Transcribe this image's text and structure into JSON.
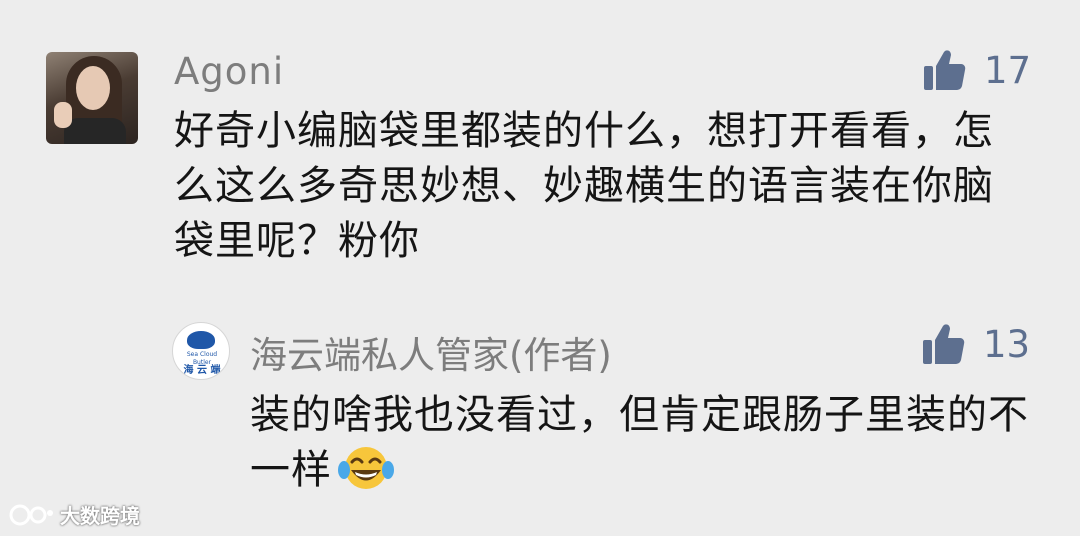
{
  "comment": {
    "username": "Agoni",
    "text": "好奇小编脑袋里都装的什么，想打开看看，怎么这么多奇思妙想、妙趣横生的语言装在你脑袋里呢？粉你",
    "likes": "17",
    "like_icon": "thumbs-up-icon"
  },
  "reply": {
    "author": "海云端私人管家(作者)",
    "avatar_text_small": "Sea Cloud Butler",
    "avatar_text": "海 云 端",
    "text": "装的啥我也没看过，但肯定跟肠子里装的不一样",
    "emoji": "laughing-tears-emoji",
    "likes": "13",
    "like_icon": "thumbs-up-icon"
  },
  "watermark": {
    "logo_icon": "dashu-logo-icon",
    "text": "大数跨境"
  },
  "colors": {
    "background": "#ededed",
    "like": "#5d6f8f",
    "name": "#7d7d7d",
    "text": "#151515"
  }
}
